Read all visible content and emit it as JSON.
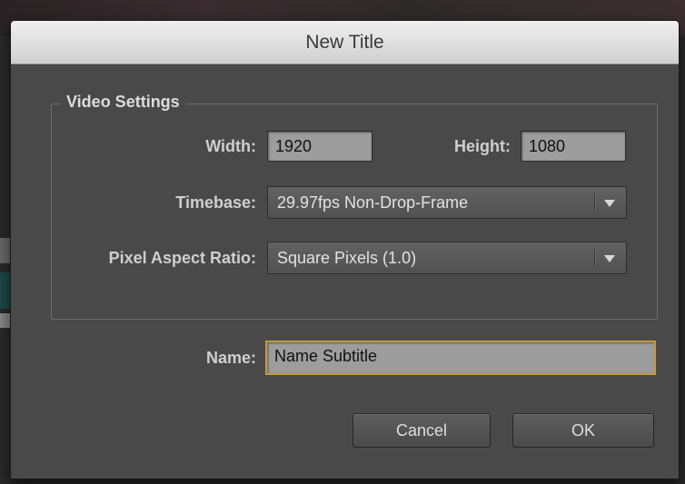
{
  "dialog": {
    "title": "New Title",
    "video_settings": {
      "legend": "Video Settings",
      "width_label": "Width:",
      "width_value": "1920",
      "height_label": "Height:",
      "height_value": "1080",
      "timebase_label": "Timebase:",
      "timebase_value": "29.97fps Non-Drop-Frame",
      "par_label": "Pixel Aspect Ratio:",
      "par_value": "Square Pixels (1.0)"
    },
    "name_label": "Name:",
    "name_value": "Name Subtitle",
    "cancel_label": "Cancel",
    "ok_label": "OK"
  },
  "colors": {
    "dialog_bg": "#494949",
    "field_bg": "#9d9d9d",
    "focus_ring": "#c79a3b",
    "titlebar_text": "#3a3a3a"
  },
  "icons": {
    "dropdown": "chevron-down-icon"
  }
}
